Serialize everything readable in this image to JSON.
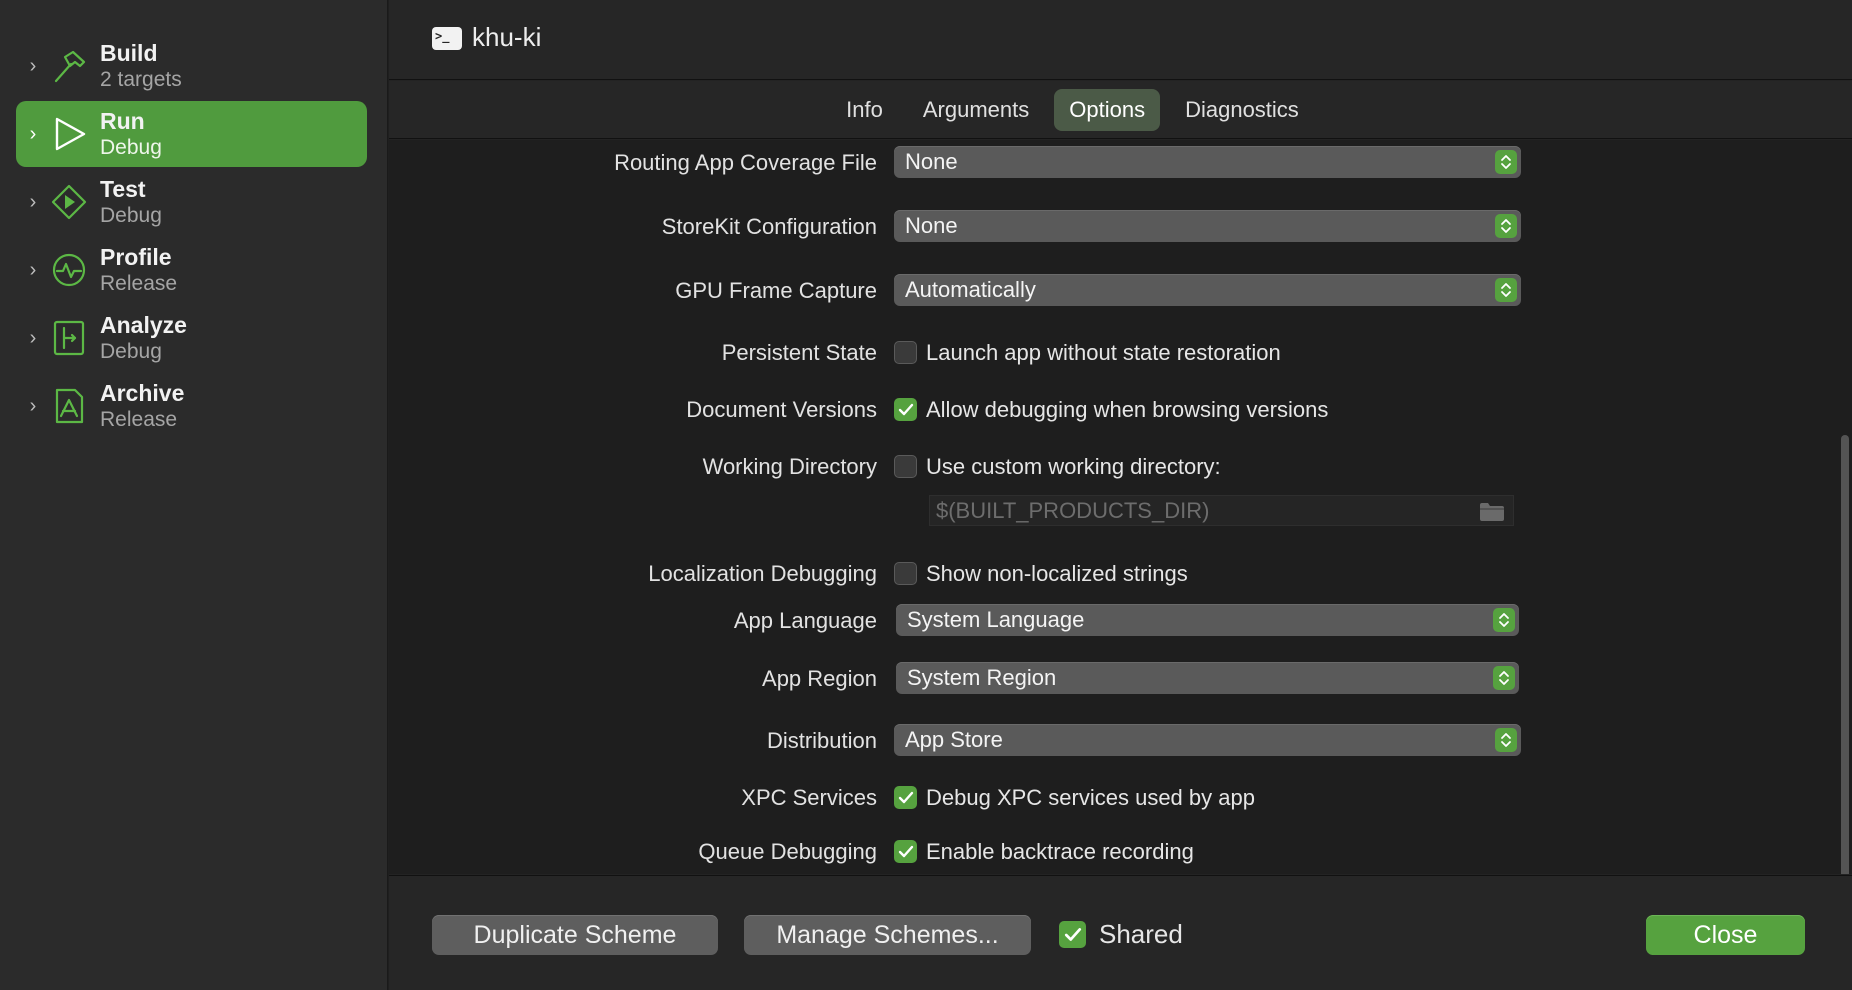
{
  "sidebar": {
    "items": [
      {
        "name": "Build",
        "sub": "2 targets",
        "icon": "hammer-icon",
        "active": false
      },
      {
        "name": "Run",
        "sub": "Debug",
        "icon": "play-icon",
        "active": true
      },
      {
        "name": "Test",
        "sub": "Debug",
        "icon": "diamond-play-icon",
        "active": false
      },
      {
        "name": "Profile",
        "sub": "Release",
        "icon": "gauge-icon",
        "active": false
      },
      {
        "name": "Analyze",
        "sub": "Debug",
        "icon": "analyze-icon",
        "active": false
      },
      {
        "name": "Archive",
        "sub": "Release",
        "icon": "archive-icon",
        "active": false
      }
    ]
  },
  "header": {
    "title": "khu-ki",
    "icon": "terminal-icon"
  },
  "tabs": [
    {
      "label": "Info",
      "active": false
    },
    {
      "label": "Arguments",
      "active": false
    },
    {
      "label": "Options",
      "active": true
    },
    {
      "label": "Diagnostics",
      "active": false
    }
  ],
  "options": {
    "routing_coverage": {
      "label": "Routing App Coverage File",
      "value": "None"
    },
    "storekit": {
      "label": "StoreKit Configuration",
      "value": "None"
    },
    "gpu_capture": {
      "label": "GPU Frame Capture",
      "value": "Automatically"
    },
    "persistent_state": {
      "label": "Persistent State",
      "check_label": "Launch app without state restoration",
      "checked": false
    },
    "document_versions": {
      "label": "Document Versions",
      "check_label": "Allow debugging when browsing versions",
      "checked": true
    },
    "working_directory": {
      "label": "Working Directory",
      "check_label": "Use custom working directory:",
      "checked": false,
      "placeholder": "$(BUILT_PRODUCTS_DIR)"
    },
    "localization_debugging": {
      "label": "Localization Debugging",
      "check_label": "Show non-localized strings",
      "checked": false
    },
    "app_language": {
      "label": "App Language",
      "value": "System Language"
    },
    "app_region": {
      "label": "App Region",
      "value": "System Region"
    },
    "distribution": {
      "label": "Distribution",
      "value": "App Store"
    },
    "xpc_services": {
      "label": "XPC Services",
      "check_label": "Debug XPC services used by app",
      "checked": true
    },
    "queue_debugging": {
      "label": "Queue Debugging",
      "check_label": "Enable backtrace recording",
      "checked": true
    }
  },
  "footer": {
    "duplicate_label": "Duplicate Scheme",
    "manage_label": "Manage Schemes...",
    "shared_label": "Shared",
    "shared_checked": true,
    "close_label": "Close"
  },
  "colors": {
    "accent": "#56a23f",
    "sidebar_active": "#509b3e",
    "background": "#1e1e1e"
  }
}
